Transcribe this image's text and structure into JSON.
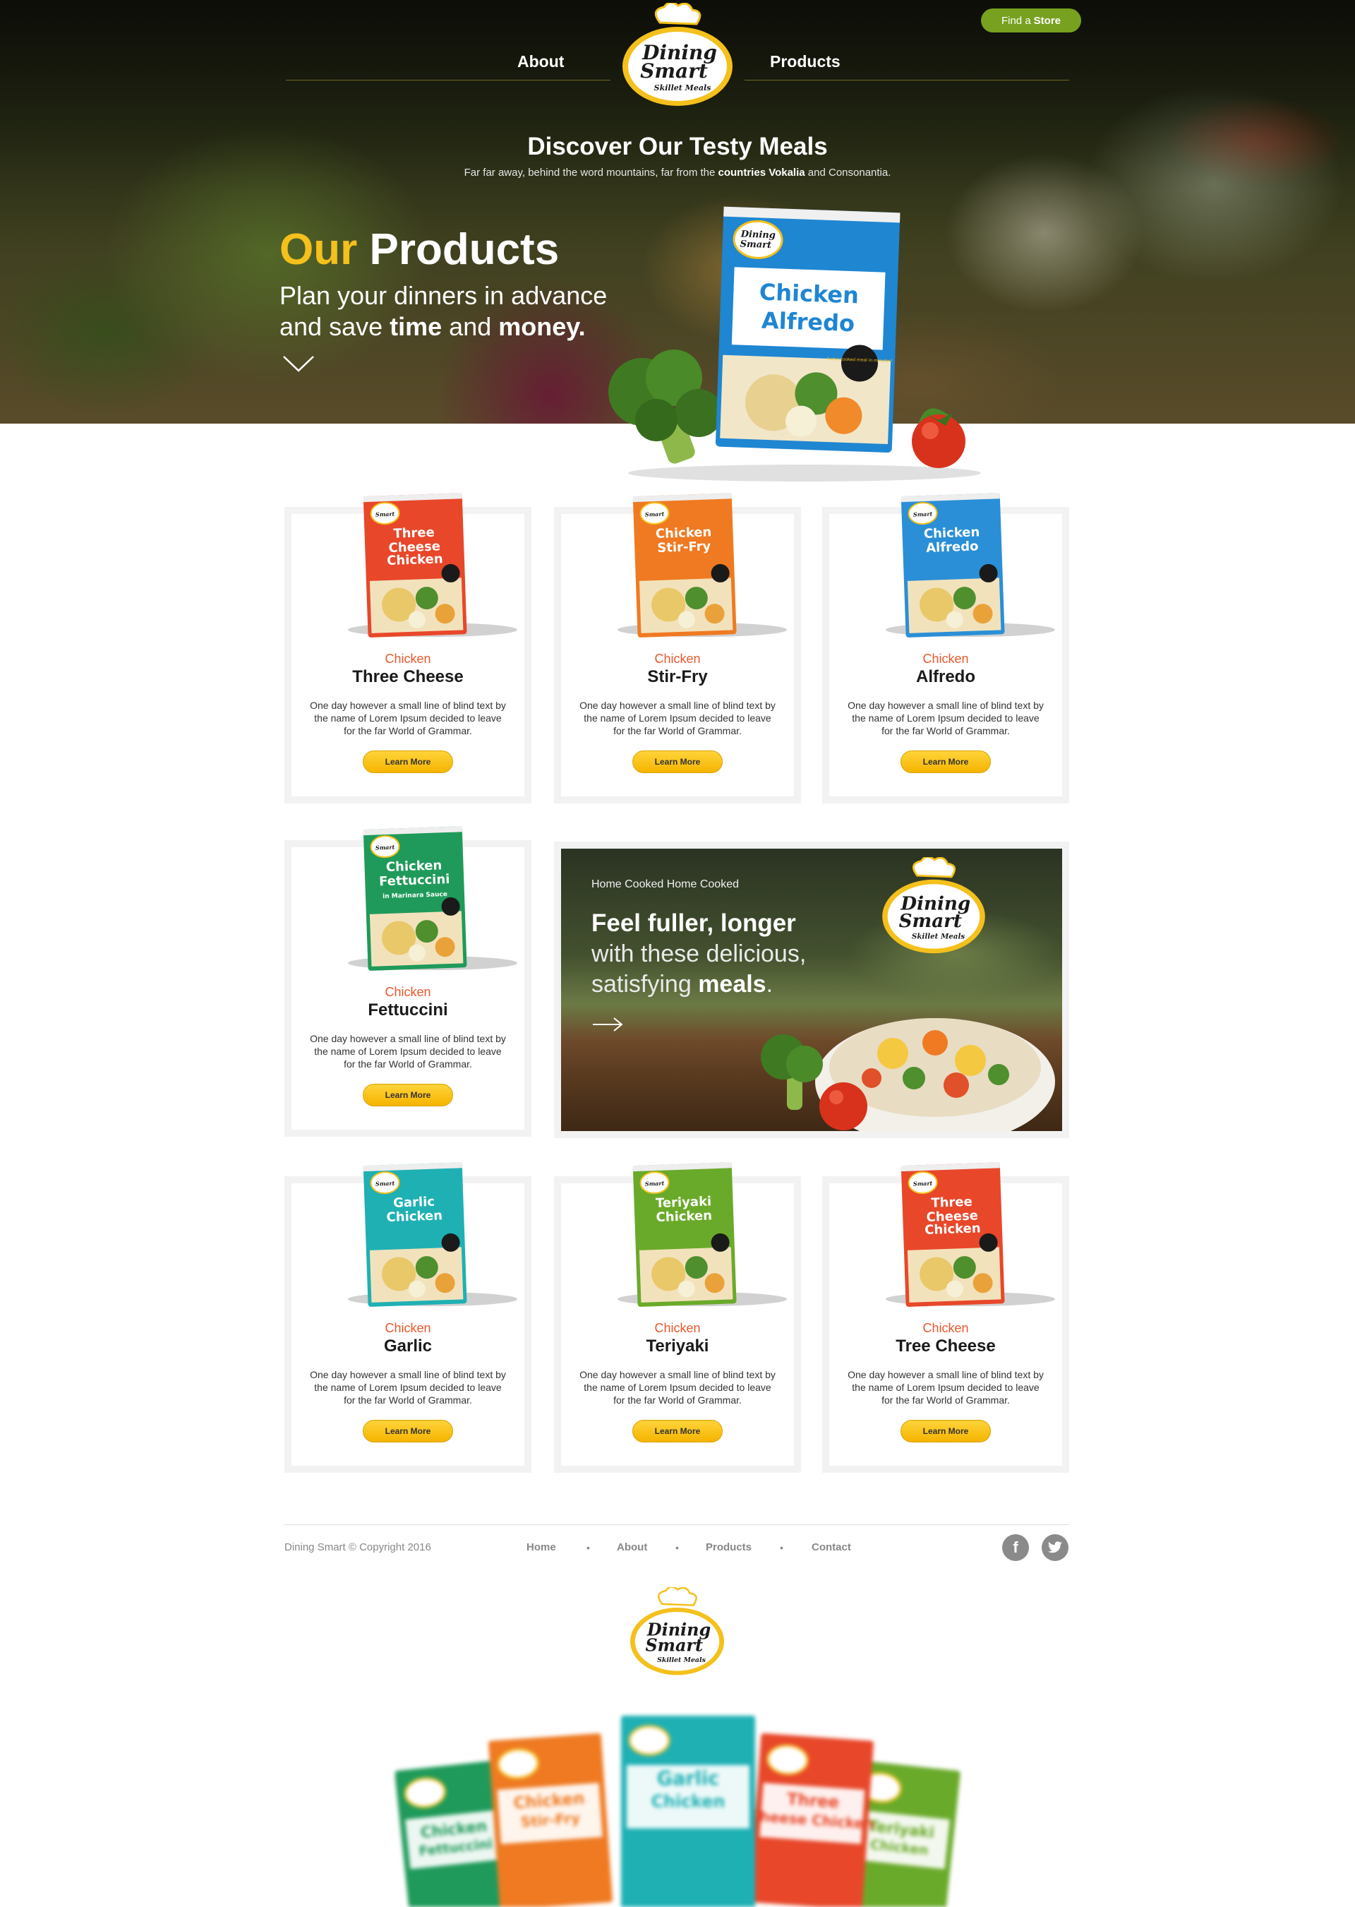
{
  "colors": {
    "accent_yellow": "#f4c01c",
    "brand_green": "#77a11f",
    "label_orange": "#e8582c",
    "button_yellow": "#ffc60f"
  },
  "header": {
    "find_store_prefix": "Find a",
    "find_store_bold": "Store",
    "nav_about": "About",
    "nav_products": "Products",
    "logo": {
      "line1": "Dining",
      "line2": "Smart",
      "line3": "Skillet Meals"
    }
  },
  "hero": {
    "title": "Discover Our Testy Meals",
    "sub_pre": "Far far away, behind the word mountains, far from the",
    "sub_bold": "countries Vokalia",
    "sub_post": "and Consonantia.",
    "our": "Our",
    "products": "Products",
    "tagline_1": "Plan your dinners in advance",
    "tagline_2_pre": "and save",
    "tagline_time": "time",
    "tagline_and": "and",
    "tagline_money": "money.",
    "package": {
      "brand1": "Dining",
      "brand2": "Smart",
      "name1": "Chicken",
      "name2": "Alfredo",
      "badge": "home cooked meal in minutes!"
    }
  },
  "cards": [
    {
      "top": "Chicken",
      "main": "Three Cheese",
      "desc": "One day however a small line of blind text by the name of Lorem Ipsum decided to leave for the far World of Grammar.",
      "button": "Learn More",
      "pkg1": "Three",
      "pkg2": "Cheese",
      "pkg3": "Chicken",
      "pkg_color": "#e8472a"
    },
    {
      "top": "Chicken",
      "main": "Stir-Fry",
      "desc": "One day however a small line of blind text by the name of Lorem Ipsum decided to leave for the far World of Grammar.",
      "button": "Learn More",
      "pkg1": "Chicken",
      "pkg2": "Stir-Fry",
      "pkg3": "",
      "pkg_color": "#ef7a22"
    },
    {
      "top": "Chicken",
      "main": "Alfredo",
      "desc": "One day however a small line of blind text by the name of Lorem Ipsum decided to leave for the far World of Grammar.",
      "button": "Learn More",
      "pkg1": "Chicken",
      "pkg2": "Alfredo",
      "pkg3": "",
      "pkg_color": "#2a8fd6"
    },
    {
      "top": "Chicken",
      "main": "Fettuccini",
      "desc": "One day however a small line of blind text by the name of Lorem Ipsum decided to leave for the far World of Grammar.",
      "button": "Learn More",
      "pkg1": "Chicken",
      "pkg2": "Fettuccini",
      "pkg3": "in Marinara Sauce",
      "pkg_color": "#1f9a5a"
    },
    {
      "top": "Chicken",
      "main": "Garlic",
      "desc": "One day however a small line of blind text by the name of Lorem Ipsum decided to leave for the far World of Grammar.",
      "button": "Learn More",
      "pkg1": "Garlic",
      "pkg2": "Chicken",
      "pkg3": "",
      "pkg_color": "#1fb0b4"
    },
    {
      "top": "Chicken",
      "main": "Teriyaki",
      "desc": "One day however a small line of blind text by the name of Lorem Ipsum decided to leave for the far World of Grammar.",
      "button": "Learn More",
      "pkg1": "Teriyaki",
      "pkg2": "Chicken",
      "pkg3": "",
      "pkg_color": "#6aaa2a"
    },
    {
      "top": "Chicken",
      "main": "Tree Cheese",
      "desc": "One day however a small line of blind text by the name of Lorem Ipsum decided to leave for the far World of Grammar.",
      "button": "Learn More",
      "pkg1": "Three",
      "pkg2": "Cheese",
      "pkg3": "Chicken",
      "pkg_color": "#e8472a"
    }
  ],
  "banner": {
    "kicker": "Home Cooked Home Cooked",
    "headline": "Feel fuller, longer",
    "line1": "with these delicious,",
    "line2_pre": "satisfying",
    "line2_bold": "meals",
    "line2_post": "."
  },
  "footer": {
    "copyright": "Dining Smart © Copyright 2016",
    "nav": [
      "Home",
      "About",
      "Products",
      "Contact"
    ],
    "facebook_glyph": "f",
    "bottom_packages": [
      {
        "name1": "Chicken",
        "name2": "Fettuccini",
        "color": "#1f9a5a"
      },
      {
        "name1": "Chicken",
        "name2": "Stir-Fry",
        "color": "#ef7a22"
      },
      {
        "name1": "Garlic",
        "name2": "Chicken",
        "color": "#1fb0b4"
      },
      {
        "name1": "Three",
        "name2": "Cheese Chicken",
        "color": "#e8472a"
      },
      {
        "name1": "Teriyaki",
        "name2": "Chicken",
        "color": "#6aaa2a"
      }
    ]
  }
}
